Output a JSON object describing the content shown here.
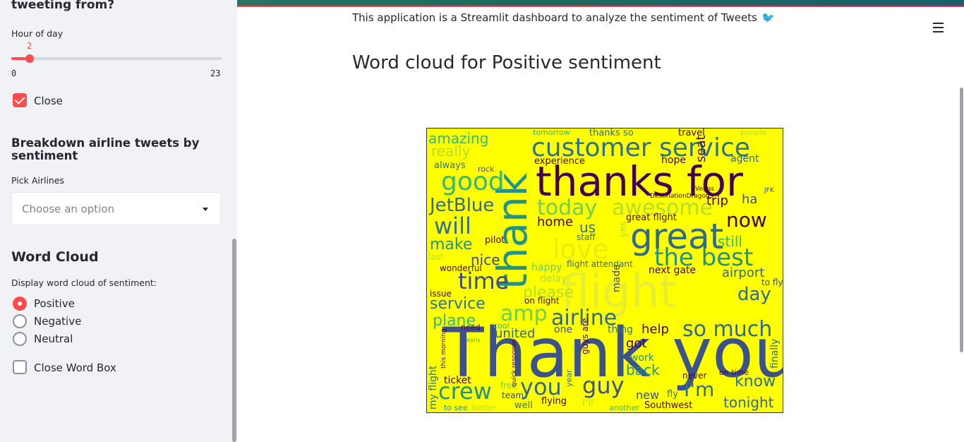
{
  "sidebar": {
    "top_heading": "tweeting from?",
    "slider": {
      "label": "Hour of day",
      "value": "2",
      "min": "0",
      "max": "23",
      "fraction": 0.087
    },
    "close_checkbox": {
      "label": "Close",
      "checked": true
    },
    "breakdown": {
      "heading": "Breakdown airline tweets by sentiment",
      "pick_label": "Pick Airlines",
      "placeholder": "Choose an option"
    },
    "word_cloud": {
      "heading": "Word Cloud",
      "radio_label": "Display word cloud of sentiment:",
      "options": [
        "Positive",
        "Negative",
        "Neutral"
      ],
      "selected": "Positive",
      "close_box_label": "Close Word Box",
      "close_box_checked": false
    }
  },
  "main": {
    "intro": "This application is a Streamlit dashboard to analyze the sentiment of Tweets",
    "intro_emoji": "🐦",
    "cloud_title": "Word cloud for Positive sentiment",
    "cloud_background": "#ffff00"
  },
  "colors": {
    "accent": "#ff4b4b",
    "sidebar_bg": "#f0f2f6",
    "text": "#262730"
  },
  "cloud_words": [
    "Thank you",
    "thanks for",
    "thank",
    "flight",
    "great",
    "customer service",
    "good",
    "JetBlue",
    "today",
    "awesome",
    "will",
    "love",
    "the best",
    "now",
    "time",
    "airline",
    "amp",
    "crew",
    "you",
    "guy",
    "so much",
    "I'm",
    "service",
    "day",
    "please",
    "plane",
    "make",
    "nice",
    "airport",
    "trip",
    "know",
    "tonight",
    "amazing",
    "really",
    "home",
    "us",
    "back",
    "help",
    "got",
    "united",
    "one",
    "thing",
    "next gate",
    "flight attendant",
    "great flight",
    "experience",
    "hope",
    "agent",
    "travel",
    "people",
    "thanks so",
    "seat",
    "still",
    "ha",
    "work",
    "new",
    "Southwest",
    "well",
    "flying",
    "ticket",
    "delay",
    "happy",
    "staff",
    "pilot",
    "issue",
    "always",
    "rock",
    "finally",
    "made",
    "yes",
    "fly",
    "never",
    "on flight",
    "tomorrow",
    "to fly",
    "DestinationDragons",
    "Vegas",
    "JFK",
    "wonderful",
    "last",
    "cool",
    "need",
    "early",
    "guys are",
    "to see",
    "better",
    "I'll",
    "another",
    "free",
    "team",
    "year",
    "quick response",
    "my flight",
    "this morning",
    "on time"
  ]
}
